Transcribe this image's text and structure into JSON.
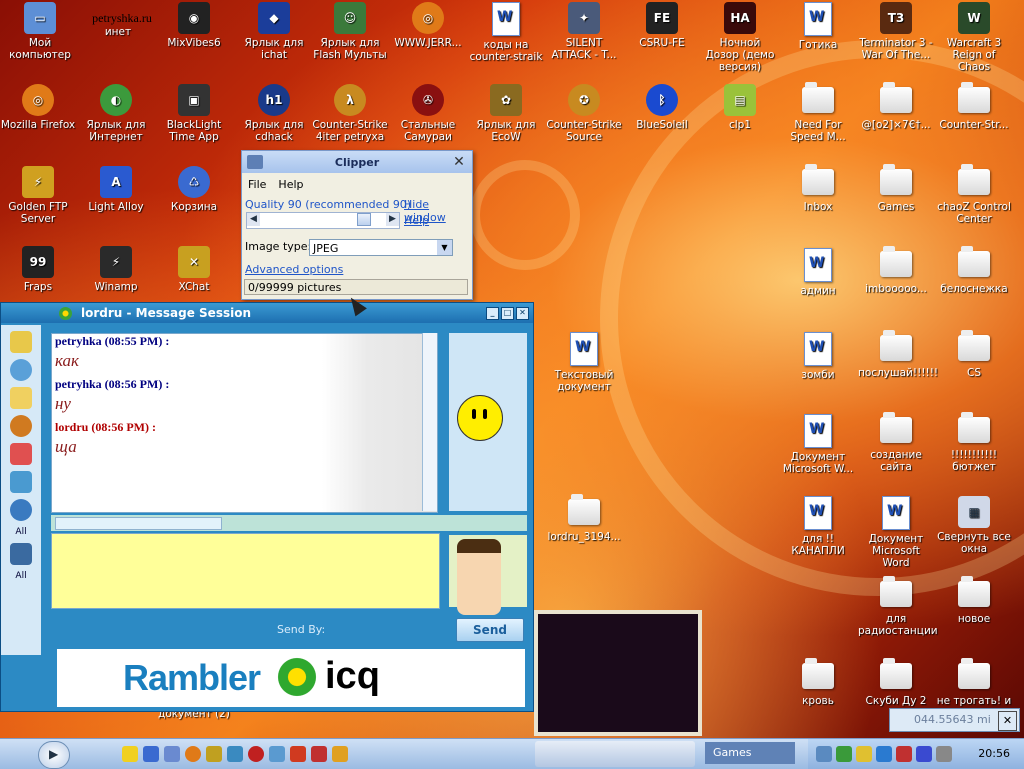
{
  "desktop": {
    "icons": [
      {
        "label": "Мой компьютер"
      },
      {
        "label": "petryshka.ru"
      },
      {
        "label": "инет"
      },
      {
        "label": "MixVibes6"
      },
      {
        "label": "Ярлык для ichat"
      },
      {
        "label": "Ярлык для Flash Мульты"
      },
      {
        "label": "WWW.JERR..."
      },
      {
        "label": "коды на counter-straik"
      },
      {
        "label": "SILENT ATTACK - T..."
      },
      {
        "label": "CSRU-FE"
      },
      {
        "label": "Ночной Дозор (демо версия)"
      },
      {
        "label": "Готика"
      },
      {
        "label": "Terminator 3 - War Of The..."
      },
      {
        "label": "Warcraft 3 Reign of Chaos"
      },
      {
        "label": "Mozilla Firefox"
      },
      {
        "label": "Ярлык для Интернет"
      },
      {
        "label": "BlackLight Time App"
      },
      {
        "label": "Ярлык для cdhack"
      },
      {
        "label": "Counter-Strike 4iter petryxa"
      },
      {
        "label": "Стальные Самураи"
      },
      {
        "label": "Ярлык для EcoW"
      },
      {
        "label": "Counter-Strike Source"
      },
      {
        "label": "BlueSoleil"
      },
      {
        "label": "clp1"
      },
      {
        "label": "Need For Speed M..."
      },
      {
        "label": "@[o2]×7€†..."
      },
      {
        "label": "Counter-Str..."
      },
      {
        "label": "Golden FTP Server"
      },
      {
        "label": "Light Alloy"
      },
      {
        "label": "Корзина"
      },
      {
        "label": "Inbox"
      },
      {
        "label": "Games"
      },
      {
        "label": "chaoZ Control Center"
      },
      {
        "label": "Fraps"
      },
      {
        "label": "Winamp"
      },
      {
        "label": "XChat"
      },
      {
        "label": "админ"
      },
      {
        "label": "imbooooo..."
      },
      {
        "label": "белоснежка"
      },
      {
        "label": "Текстовый документ"
      },
      {
        "label": "зомби"
      },
      {
        "label": "послушай!!!!!!"
      },
      {
        "label": "CS"
      },
      {
        "label": "Документ Microsoft W..."
      },
      {
        "label": "создание сайта"
      },
      {
        "label": "!!!!!!!!!!! бютжет"
      },
      {
        "label": "lordru_3194..."
      },
      {
        "label": "для !! КАНАПЛИ"
      },
      {
        "label": "Документ Microsoft Word"
      },
      {
        "label": "Свернуть все окна"
      },
      {
        "label": "для радиостанции"
      },
      {
        "label": "новое"
      },
      {
        "label": "кровь"
      },
      {
        "label": "Скуби Ду 2"
      },
      {
        "label": "не трогать! и"
      },
      {
        "label": "документ (2)"
      }
    ]
  },
  "clipper": {
    "title": "Clipper",
    "menu": [
      "File",
      "Help"
    ],
    "quality": "Quality 90 (recommended 90)",
    "hide_window": "Hide window",
    "help_link": "Help",
    "image_type_label": "Image type:",
    "image_type_value": "JPEG",
    "advanced": "Advanced options",
    "status": "0/99999 pictures",
    "quality_level_percent": 90
  },
  "icq": {
    "title": "lordru - Message Session",
    "messages": [
      {
        "sender": "petryhka (08:55 PM) :",
        "text": "как",
        "color": "#000080"
      },
      {
        "sender": "petryhka (08:56 PM) :",
        "text": "ну",
        "color": "#000080"
      },
      {
        "sender": "lordru (08:56 PM) :",
        "text": "ща",
        "color": "#b00000"
      }
    ],
    "all_label_1": "All",
    "all_label_2": "All",
    "send_by": "Send By:",
    "send": "Send",
    "banner_left": "Rambler",
    "banner_right": "icq"
  },
  "popup": {
    "value": "044.55643 mi"
  },
  "taskbar": {
    "task_games": "Games",
    "clock": "20:56"
  },
  "colors": {
    "icq_blue": "#2c8ac4",
    "input_yellow": "#ffff99",
    "wallpaper_red": "#d2340a"
  }
}
